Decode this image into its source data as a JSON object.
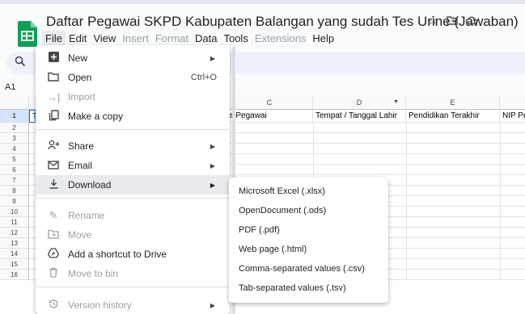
{
  "title": "Daftar Pegawai SKPD Kabupaten Balangan yang sudah Tes Urine (Jawaban)",
  "colors": {
    "brand": "#0f9d58",
    "accent": "#0b57d0",
    "menu_highlight": "#e8eaed"
  },
  "title_icons": [
    "star-icon",
    "move-to-folder-icon",
    "cloud-status-icon"
  ],
  "menubar": [
    "File",
    "Edit",
    "View",
    "Insert",
    "Format",
    "Data",
    "Tools",
    "Extensions",
    "Help"
  ],
  "name_box": "A1",
  "columns": [
    "C",
    "D",
    "E"
  ],
  "header_row": {
    "a": "T",
    "c": "a Pegawai",
    "d": "Tempat / Tanggal Lahir",
    "e": "Pendidikan Terakhir",
    "f": "NIP Pe"
  },
  "row_numbers": [
    "1",
    "2",
    "3",
    "4",
    "5",
    "6",
    "7",
    "8",
    "9",
    "10",
    "11",
    "12",
    "13",
    "14",
    "15",
    "16"
  ],
  "file_menu": [
    {
      "label": "New",
      "icon": "plus-box-icon",
      "arrow": true
    },
    {
      "label": "Open",
      "icon": "folder-icon",
      "shortcut": "Ctrl+O"
    },
    {
      "label": "Import",
      "icon": "import-icon",
      "disabled": true
    },
    {
      "label": "Make a copy",
      "icon": "copy-icon"
    },
    {
      "label": "Share",
      "icon": "person-add-icon",
      "arrow": true
    },
    {
      "label": "Email",
      "icon": "mail-icon",
      "arrow": true
    },
    {
      "label": "Download",
      "icon": "download-icon",
      "arrow": true,
      "highlighted": true
    },
    {
      "label": "Rename",
      "icon": "rename-icon",
      "disabled": true
    },
    {
      "label": "Move",
      "icon": "move-icon",
      "disabled": true
    },
    {
      "label": "Add a shortcut to Drive",
      "icon": "drive-shortcut-icon"
    },
    {
      "label": "Move to bin",
      "icon": "trash-icon",
      "disabled": true
    },
    {
      "label": "Version history",
      "icon": "history-icon",
      "arrow": true,
      "disabled": true
    }
  ],
  "download_submenu": [
    "Microsoft Excel (.xlsx)",
    "OpenDocument (.ods)",
    "PDF (.pdf)",
    "Web page (.html)",
    "Comma-separated values (.csv)",
    "Tab-separated values (.tsv)"
  ]
}
